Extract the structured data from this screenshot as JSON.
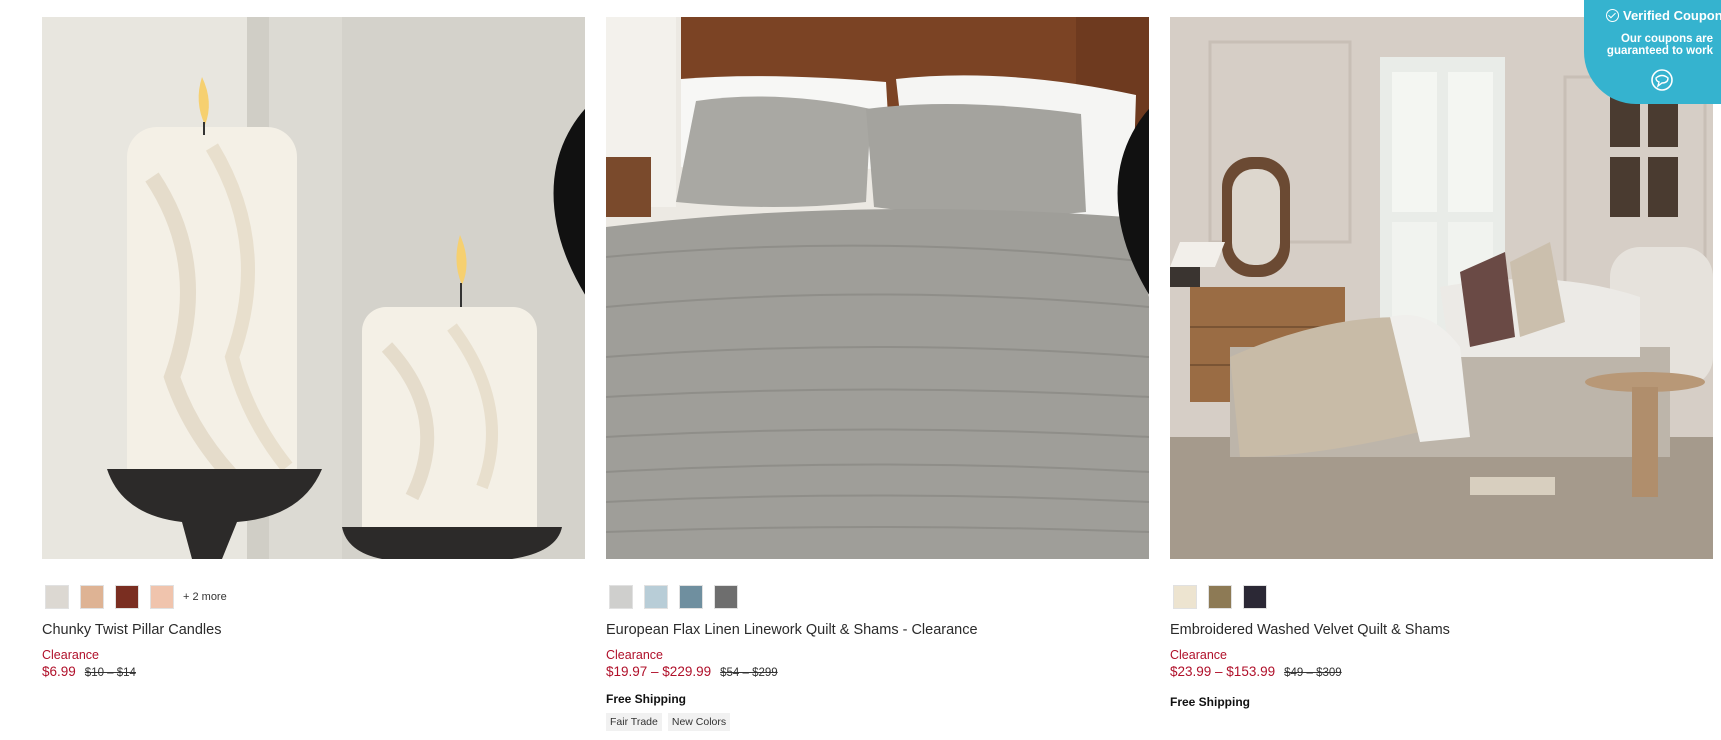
{
  "products": [
    {
      "name": "Chunky Twist Pillar Candles",
      "promo": "Clearance",
      "price": "$6.99",
      "original_price": "$10 – $14",
      "swatches": [
        "#dcd8d2",
        "#deb394",
        "#7a2e21",
        "#f0c4ad"
      ],
      "more_label": "+ 2 more",
      "shipping": "",
      "tags": []
    },
    {
      "name": "European Flax Linen Linework Quilt & Shams - Clearance",
      "promo": "Clearance",
      "price": "$19.97 – $229.99",
      "original_price": "$54 – $299",
      "swatches": [
        "#cfcfcd",
        "#b8cdd7",
        "#6f8f9f",
        "#6e6e6e"
      ],
      "more_label": "",
      "shipping": "Free Shipping",
      "tags": [
        "Fair Trade",
        "New Colors"
      ]
    },
    {
      "name": "Embroidered Washed Velvet Quilt & Shams",
      "promo": "Clearance",
      "price": "$23.99 – $153.99",
      "original_price": "$49 – $309",
      "swatches": [
        "#ede4d0",
        "#8d7a55",
        "#2b2835"
      ],
      "more_label": "",
      "shipping": "Free Shipping",
      "tags": []
    }
  ],
  "coupon": {
    "title": "Verified Coupon",
    "subtitle": "Our coupons are guaranteed to work",
    "color": "#35b3cf"
  },
  "colors": {
    "sale": "#b0102a"
  },
  "icons": [
    "heart-icon",
    "check-circle-icon",
    "chat-icon"
  ]
}
